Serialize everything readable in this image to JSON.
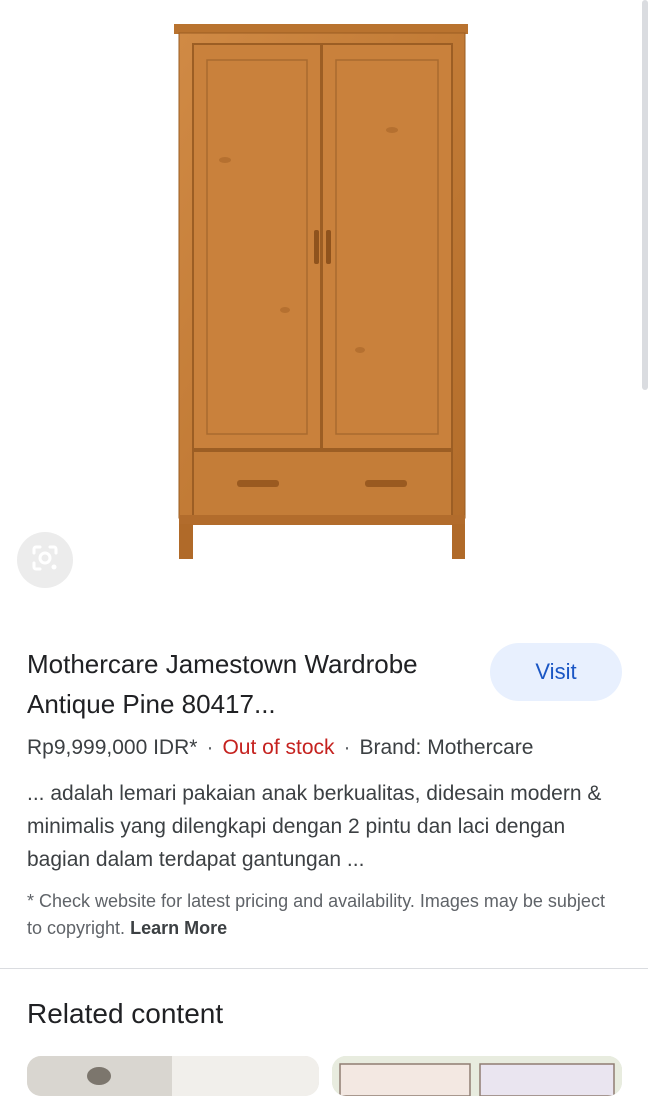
{
  "product": {
    "image_alt": "wardrobe-image",
    "title": "Mothercare Jamestown Wardrobe Antique Pine 80417...",
    "visit_label": "Visit",
    "price": "Rp9,999,000 IDR*",
    "stock_status": "Out of stock",
    "brand": "Brand: Mothercare",
    "description": "... adalah lemari pakaian anak berkualitas, didesain modern & minimalis yang dilengkapi dengan 2 pintu dan laci dengan bagian dalam terdapat gantungan ...",
    "disclaimer": "* Check website for latest pricing and availability. Images may be subject to copyright.",
    "learn_more": "Learn More"
  },
  "related": {
    "title": "Related content"
  },
  "colors": {
    "wood": "#c8843e",
    "wood_dark": "#a86628",
    "accent_blue": "#1a56c4",
    "out_of_stock": "#c5221f"
  },
  "icons": {
    "lens": "lens-icon"
  }
}
